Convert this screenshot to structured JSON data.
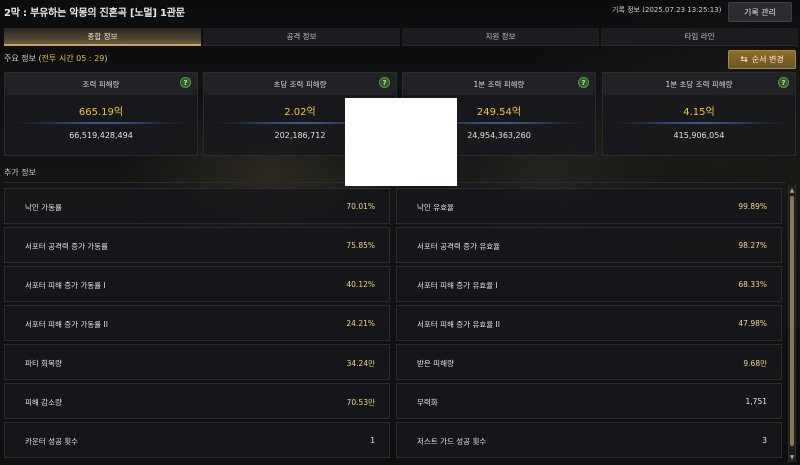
{
  "header": {
    "title": "2막 : 부유하는 악몽의 진혼곡 [노멀] 1관문",
    "record_info": "기록 정보 (2025.07.23 13:25:13)",
    "record_manage_label": "기록 관리"
  },
  "tabs": [
    {
      "label": "종합 정보",
      "active": true
    },
    {
      "label": "공격 정보",
      "active": false
    },
    {
      "label": "지원 정보",
      "active": false
    },
    {
      "label": "타임 라인",
      "active": false
    }
  ],
  "main": {
    "label_prefix": "주요 정보 (",
    "battle_time": "전투 시간 05 : 29",
    "label_suffix": ")",
    "order_button_label": "순서 변경"
  },
  "cards": [
    {
      "title": "조력 피해량",
      "value": "665.19억",
      "raw": "66,519,428,494"
    },
    {
      "title": "초당 조력 피해량",
      "value": "2.02억",
      "raw": "202,186,712"
    },
    {
      "title": "1분 조력 피해량",
      "value": "249.54억",
      "raw": "24,954,363,260"
    },
    {
      "title": "1분 초당 조력 피해량",
      "value": "4.15억",
      "raw": "415,906,054"
    }
  ],
  "extra": {
    "label": "추가 정보",
    "rows": [
      {
        "left_label": "낙인 가동률",
        "left_value": "70.01%",
        "right_label": "낙인 유효율",
        "right_value": "99.89%"
      },
      {
        "left_label": "서포터 공격력 증가 가동률",
        "left_value": "75.85%",
        "right_label": "서포터 공격력 증가 유효율",
        "right_value": "98.27%"
      },
      {
        "left_label": "서포터 피해 증가 가동률 I",
        "left_value": "40.12%",
        "right_label": "서포터 피해 증가 유효율 I",
        "right_value": "68.33%"
      },
      {
        "left_label": "서포터 피해 증가 가동률 II",
        "left_value": "24.21%",
        "right_label": "서포터 피해 증가 유효율 II",
        "right_value": "47.98%"
      },
      {
        "left_label": "파티 회복량",
        "left_value": "34.24만",
        "right_label": "받은 피해량",
        "right_value": "9.68만"
      },
      {
        "left_label": "피해 감소량",
        "left_value": "70.53만",
        "right_label": "무력화",
        "right_value": "1,751"
      },
      {
        "left_label": "카운터 성공 횟수",
        "left_value": "1",
        "right_label": "저스트 가드 성공 횟수",
        "right_value": "3"
      }
    ]
  },
  "icons": {
    "help": "question-icon",
    "swap": "swap-arrows-icon",
    "scroll_up": "scroll-up-icon",
    "scroll_down": "scroll-down-icon"
  },
  "colors": {
    "accent_gold": "#f1c242",
    "active_tab_border": "#c8a24e",
    "order_button": "#8c6f2b"
  }
}
